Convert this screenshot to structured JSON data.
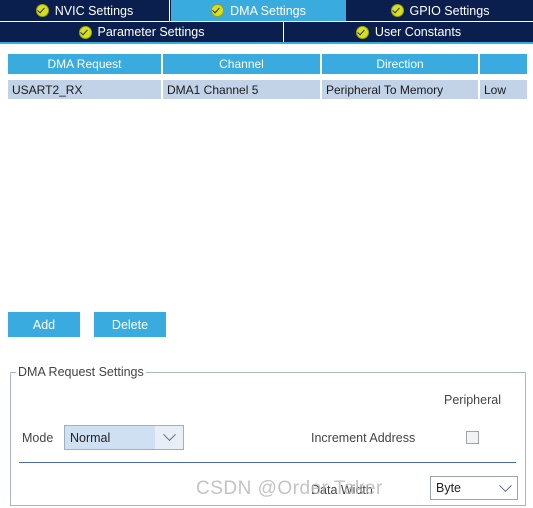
{
  "tabs": {
    "row1": [
      {
        "label": "NVIC Settings",
        "icon": "check-circle-icon",
        "active": false
      },
      {
        "label": "DMA Settings",
        "icon": "check-circle-icon",
        "active": true
      },
      {
        "label": "GPIO Settings",
        "icon": "check-circle-icon",
        "active": false
      }
    ],
    "row2": [
      {
        "label": "Parameter Settings",
        "icon": "check-circle-icon",
        "active": false
      },
      {
        "label": "User Constants",
        "icon": "check-circle-icon",
        "active": false
      }
    ]
  },
  "table": {
    "columns": [
      "DMA Request",
      "Channel",
      "Direction",
      ""
    ],
    "rows": [
      {
        "dma_request": "USART2_RX",
        "channel": "DMA1 Channel 5",
        "direction": "Peripheral To Memory",
        "priority": "Low"
      }
    ]
  },
  "buttons": {
    "add": "Add",
    "delete": "Delete"
  },
  "group": {
    "title": "DMA Request Settings",
    "peripheral_header": "Peripheral",
    "mode_label": "Mode",
    "mode_value": "Normal",
    "increment_address_label": "Increment Address",
    "increment_address_checked": false,
    "data_width_label": "Data Width",
    "data_width_value": "Byte"
  },
  "watermark": "CSDN @Order Taker",
  "colors": {
    "tab_bar_dark": "#0b1f4e",
    "accent_blue": "#3aabdf",
    "row_selected": "#c2d3e8",
    "check_icon": "#d7df23"
  }
}
